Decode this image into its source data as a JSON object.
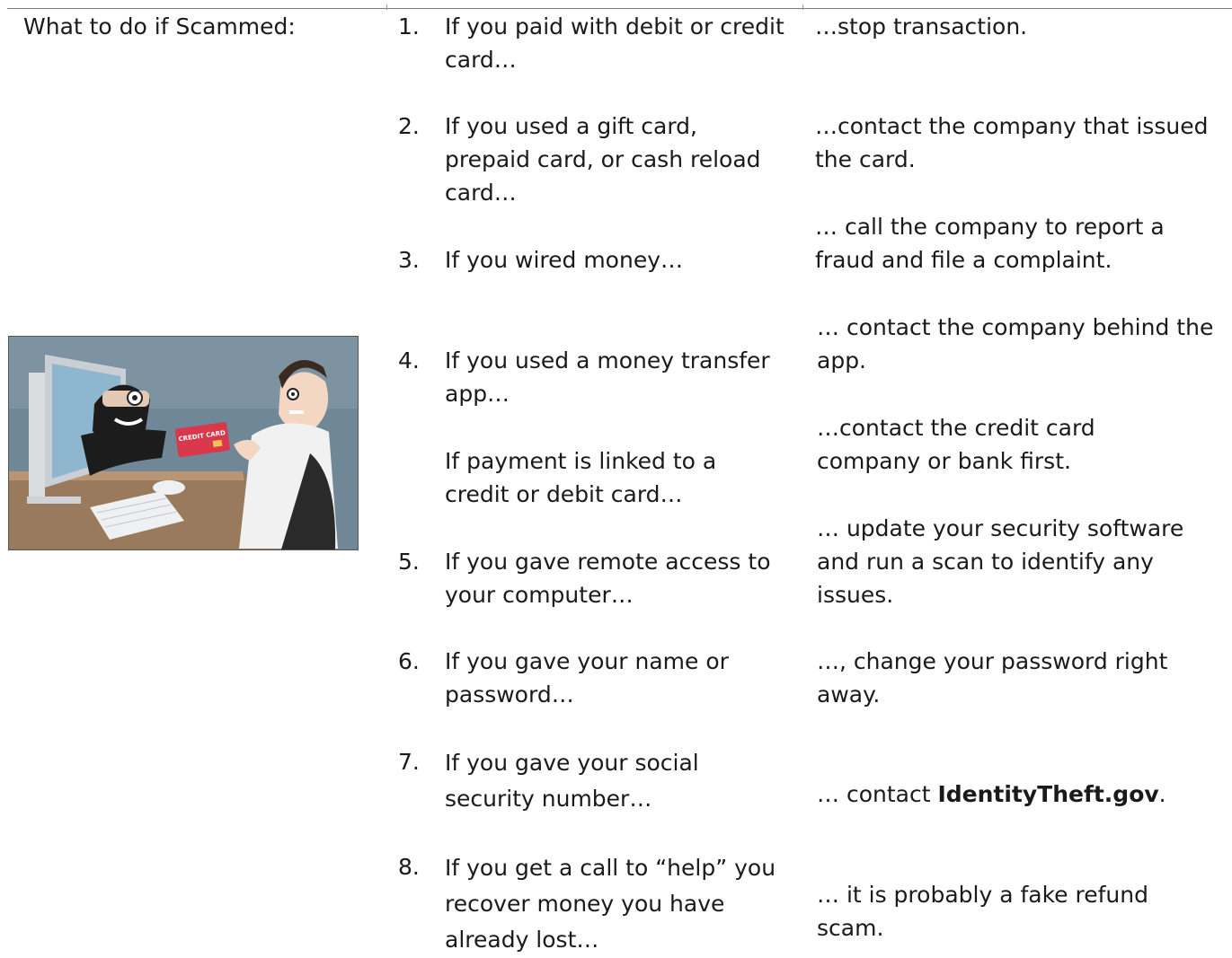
{
  "heading": "What to do if Scammed:",
  "illustration": {
    "name": "scammer-stealing-credit-card-illustration",
    "card_text": "CREDIT CARD"
  },
  "items": [
    {
      "number": "1.",
      "question": "If you paid with debit or credit card…",
      "answer": "…stop transaction."
    },
    {
      "number": "2.",
      "question": "If you used a gift card, prepaid card, or cash reload card…",
      "answer": "…contact the company that issued the card."
    },
    {
      "number": "3.",
      "question": "If you wired money…",
      "answer": "… call the company to report a fraud and file a complaint."
    },
    {
      "number": "4.",
      "question": "If you used a money transfer app…",
      "answer": "… contact the company behind the app."
    },
    {
      "number": "",
      "question": "If payment is linked to a credit or debit card…",
      "answer": "…contact the credit card company or bank first."
    },
    {
      "number": "5.",
      "question": "If you gave remote access to your computer…",
      "answer": "… update your security software and run a scan to identify any issues."
    },
    {
      "number": "6.",
      "question": "If you gave your name or password…",
      "answer": "…, change your password right away."
    },
    {
      "number": "7.",
      "question": "If you gave your social security number…",
      "answer_prefix": "… contact ",
      "answer_bold": "IdentityTheft.gov",
      "answer_suffix": "."
    },
    {
      "number": "8.",
      "question": "If you get a call to “help” you recover money you have already lost…",
      "answer": "… it is probably a fake refund scam."
    }
  ]
}
